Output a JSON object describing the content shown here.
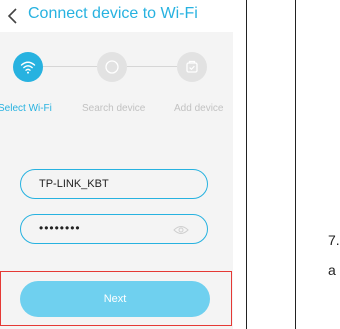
{
  "header": {
    "back_icon": "chevron-left-icon",
    "title": "Connect device to Wi-Fi"
  },
  "steps": [
    {
      "label": "Select Wi-Fi",
      "icon": "wifi-icon",
      "state": "active"
    },
    {
      "label": "Search device",
      "icon": "search-icon",
      "state": "inactive"
    },
    {
      "label": "Add device",
      "icon": "device-add-icon",
      "state": "inactive"
    }
  ],
  "form": {
    "ssid_value": "TP-LINK_KBT",
    "password_value": "••••••••",
    "password_toggle_icon": "eye-icon"
  },
  "next_label": "Next",
  "side": {
    "line1": "7.",
    "line2": "a"
  },
  "colors": {
    "accent": "#27b2e0",
    "button": "#6fd0ef",
    "highlight": "#e53935"
  }
}
